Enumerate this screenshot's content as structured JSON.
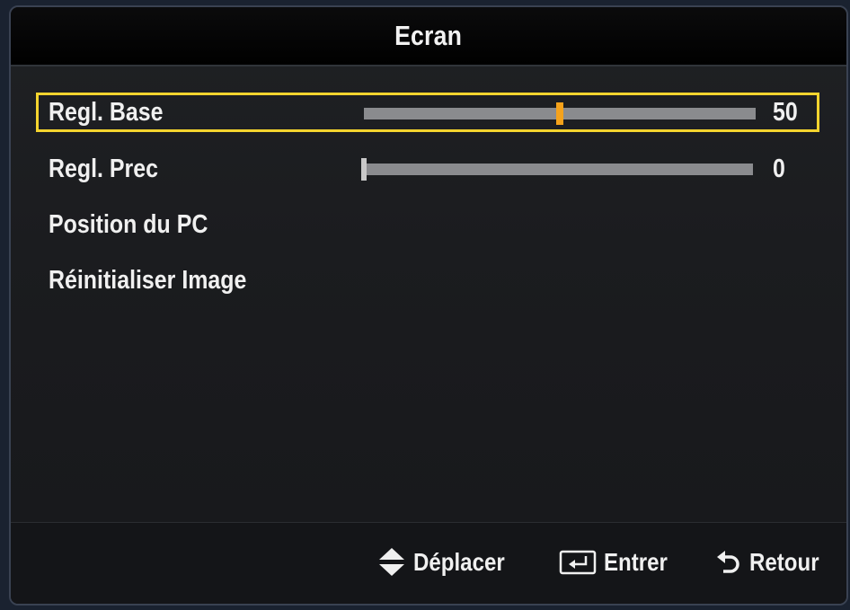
{
  "window": {
    "title": "Ecran"
  },
  "menu": {
    "items": [
      {
        "label": "Regl. Base",
        "has_slider": true,
        "value": "50",
        "level": 0.5,
        "selected": true
      },
      {
        "label": "Regl. Prec",
        "has_slider": true,
        "value": "0",
        "level": 0.0,
        "selected": false
      },
      {
        "label": "Position du PC",
        "has_slider": false,
        "selected": false
      },
      {
        "label": "Réinitialiser Image",
        "has_slider": false,
        "selected": false
      }
    ]
  },
  "footer": {
    "move_label": "Déplacer",
    "move_icon": "up-down-arrows-icon",
    "enter_label": "Entrer",
    "enter_icon": "enter-icon",
    "return_label": "Retour",
    "return_icon": "return-icon"
  },
  "colors": {
    "highlight": "#f4d42e",
    "slider_thumb": "#f5a21b",
    "slider_track": "#8a8b8e"
  }
}
